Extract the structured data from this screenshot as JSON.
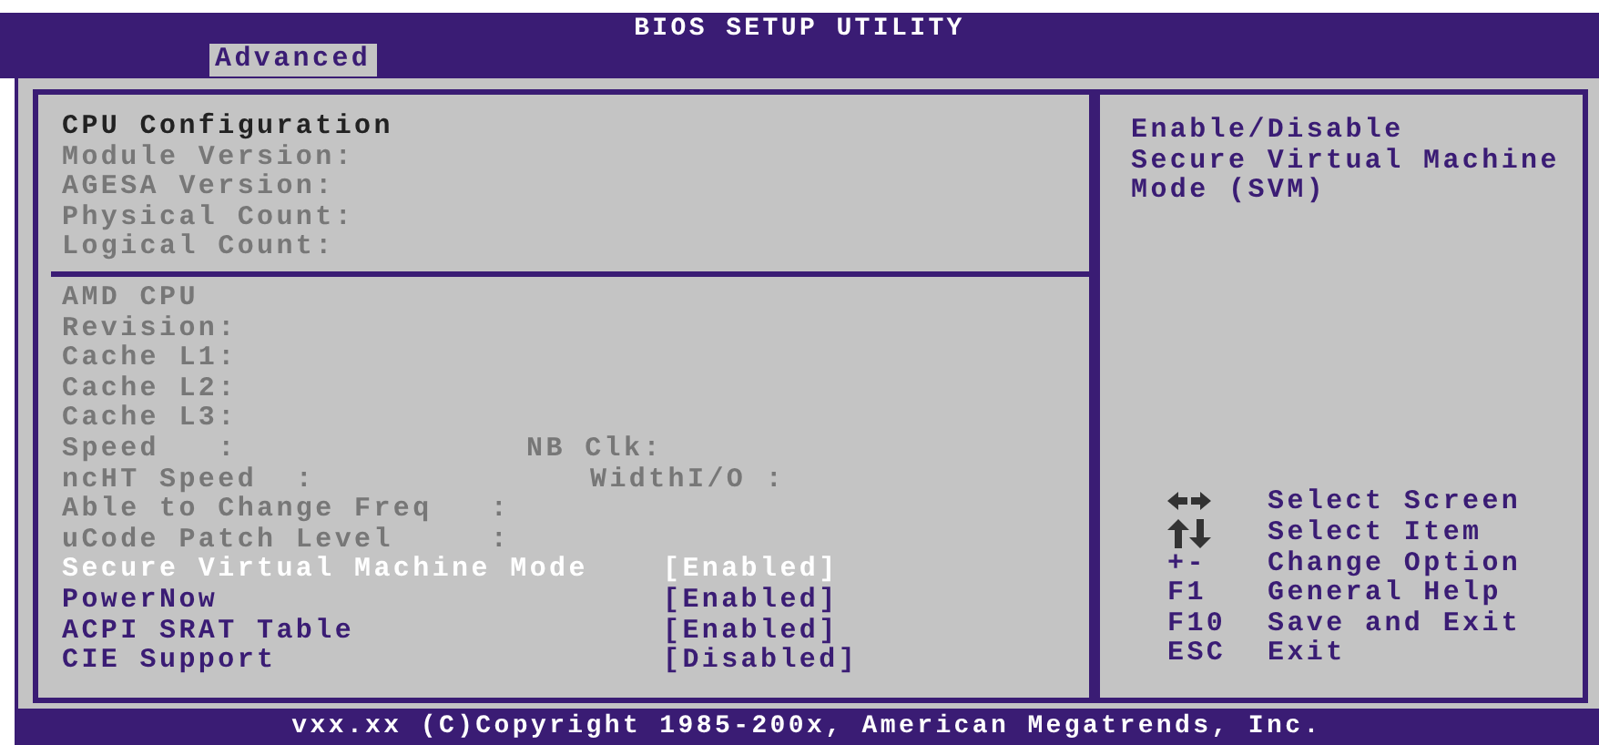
{
  "title": "BIOS SETUP UTILITY",
  "tabs": [
    {
      "label": "Advanced",
      "selected": true
    }
  ],
  "heading": "CPU Configuration",
  "sections": [
    {
      "items": [
        {
          "kind": "info",
          "text": "Module Version:"
        },
        {
          "kind": "info",
          "text": "AGESA Version:"
        },
        {
          "kind": "info",
          "text": "Physical Count:"
        },
        {
          "kind": "info",
          "text": "Logical Count:"
        }
      ]
    },
    {
      "items": [
        {
          "kind": "info",
          "text": "AMD CPU"
        },
        {
          "kind": "info",
          "text": "Revision:"
        },
        {
          "kind": "info",
          "text": "Cache L1:"
        },
        {
          "kind": "info",
          "text": "Cache L2:"
        },
        {
          "kind": "info",
          "text": "Cache L3:"
        },
        {
          "kind": "info",
          "text": "Speed   :",
          "extra": "NB Clk:",
          "indent": false
        },
        {
          "kind": "info",
          "text": "ncHT Speed  :",
          "extra": "WidthI/O :",
          "indent": true
        },
        {
          "kind": "info",
          "text": "Able to Change Freq   :"
        },
        {
          "kind": "info",
          "text": "uCode Patch Level     :"
        },
        {
          "kind": "setting",
          "text": "Secure Virtual Machine Mode",
          "value": "[Enabled]",
          "selected": true
        },
        {
          "kind": "setting",
          "text": "PowerNow",
          "value": "[Enabled]",
          "selected": false
        },
        {
          "kind": "setting",
          "text": "ACPI SRAT Table",
          "value": "[Enabled]",
          "selected": false
        },
        {
          "kind": "setting",
          "text": "CIE Support",
          "value": "[Disabled]",
          "selected": false
        }
      ]
    }
  ],
  "help": [
    "Enable/Disable",
    "Secure Virtual Machine",
    "Mode (SVM)"
  ],
  "keys": [
    {
      "kind": "arrows-lr",
      "desc": "Select Screen"
    },
    {
      "kind": "arrows-ud",
      "desc": "Select Item"
    },
    {
      "kind": "text",
      "key": "+-",
      "desc": "Change Option"
    },
    {
      "kind": "text",
      "key": "F1",
      "desc": "General Help"
    },
    {
      "kind": "text",
      "key": "F10",
      "desc": "Save and Exit"
    },
    {
      "kind": "text",
      "key": "ESC",
      "desc": "Exit"
    }
  ],
  "footer": "vxx.xx (C)Copyright 1985-200x, American Megatrends, Inc."
}
